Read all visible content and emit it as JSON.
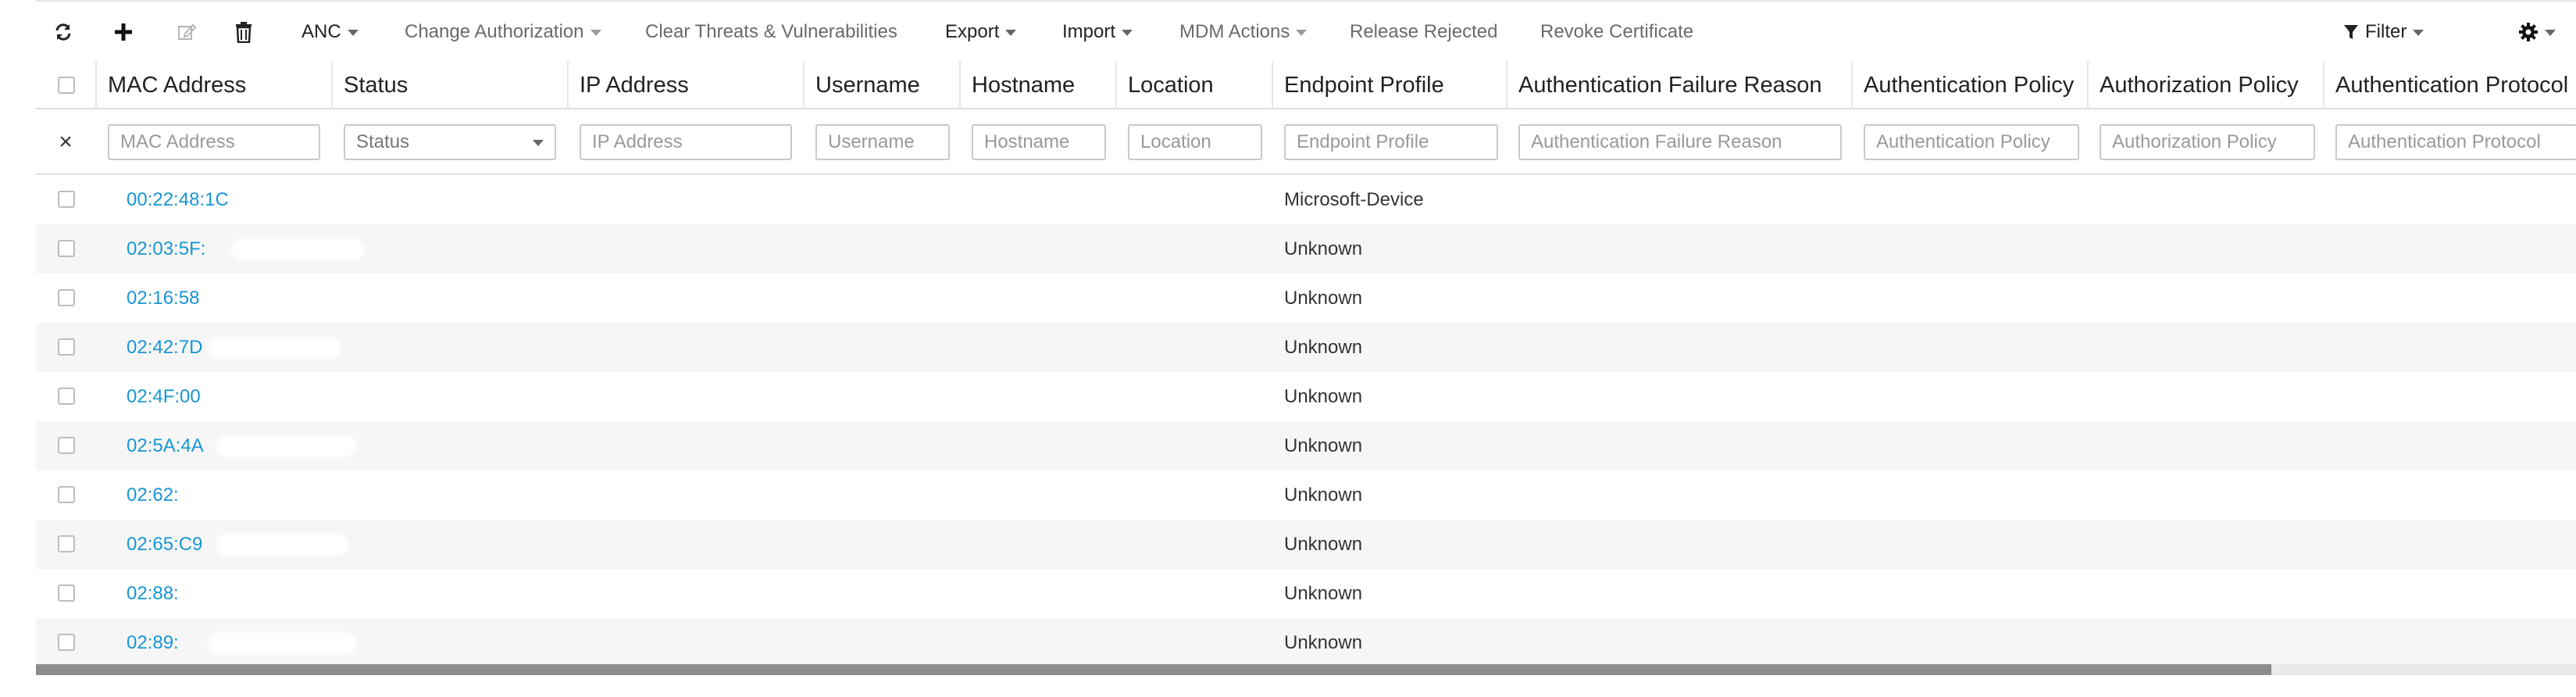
{
  "toolbar": {
    "refresh_icon": "refresh-icon",
    "add_icon": "plus-icon",
    "edit_icon": "edit-icon",
    "delete_icon": "trash-icon",
    "anc": "ANC",
    "change_authorization": "Change Authorization",
    "clear_threats": "Clear Threats & Vulnerabilities",
    "export": "Export",
    "import": "Import",
    "mdm_actions": "MDM Actions",
    "release_rejected": "Release Rejected",
    "revoke_certificate": "Revoke Certificate",
    "filter": "Filter",
    "settings_icon": "gear-icon"
  },
  "columns": [
    {
      "key": "mac",
      "label": "MAC Address",
      "placeholder": "MAC Address"
    },
    {
      "key": "status",
      "label": "Status",
      "placeholder": "Status"
    },
    {
      "key": "ip",
      "label": "IP Address",
      "placeholder": "IP Address"
    },
    {
      "key": "username",
      "label": "Username",
      "placeholder": "Username"
    },
    {
      "key": "hostname",
      "label": "Hostname",
      "placeholder": "Hostname"
    },
    {
      "key": "location",
      "label": "Location",
      "placeholder": "Location"
    },
    {
      "key": "profile",
      "label": "Endpoint Profile",
      "placeholder": "Endpoint Profile"
    },
    {
      "key": "authfail",
      "label": "Authentication Failure Reason",
      "placeholder": "Authentication Failure Reason"
    },
    {
      "key": "authpol",
      "label": "Authentication Policy",
      "placeholder": "Authentication Policy"
    },
    {
      "key": "authzpol",
      "label": "Authorization Policy",
      "placeholder": "Authorization Policy"
    },
    {
      "key": "authproto",
      "label": "Authentication Protocol",
      "placeholder": "Authentication Protocol"
    }
  ],
  "filter_clear": "×",
  "rows": [
    {
      "mac": "00:22:48:1C",
      "profile": "Microsoft-Device"
    },
    {
      "mac": "02:03:5F:",
      "profile": "Unknown"
    },
    {
      "mac": "02:16:58",
      "profile": "Unknown"
    },
    {
      "mac": "02:42:7D",
      "profile": "Unknown"
    },
    {
      "mac": "02:4F:00",
      "profile": "Unknown"
    },
    {
      "mac": "02:5A:4A",
      "profile": "Unknown"
    },
    {
      "mac": "02:62:",
      "profile": "Unknown"
    },
    {
      "mac": "02:65:C9",
      "profile": "Unknown"
    },
    {
      "mac": "02:88:",
      "profile": "Unknown"
    },
    {
      "mac": "02:89:",
      "profile": "Unknown"
    }
  ],
  "scrollbar": {
    "visible_fraction": 0.88
  }
}
